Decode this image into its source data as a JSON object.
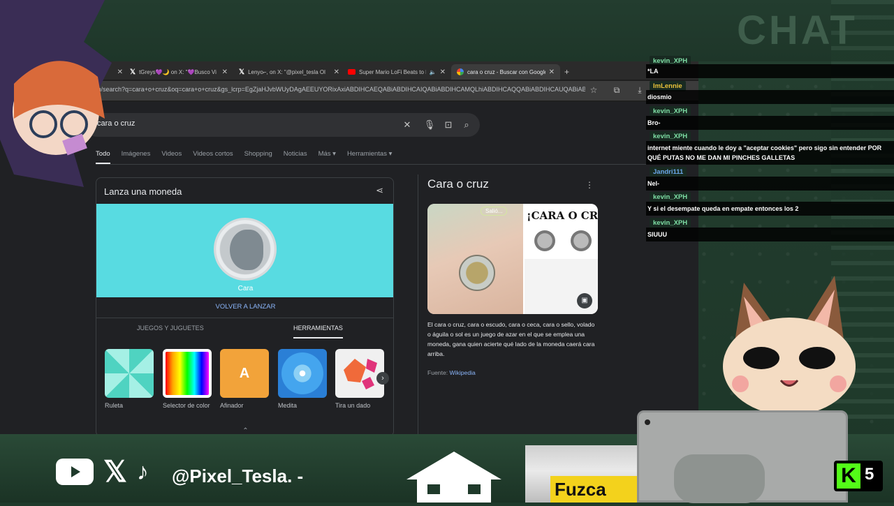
{
  "overlay": {
    "chat_title": "CHAT",
    "handle": "@Pixel_Tesla. -",
    "brand": "Fuzca",
    "kick_count": "5"
  },
  "browser": {
    "tabs": [
      {
        "title": "",
        "favicon": "x-icon"
      },
      {
        "title": "tGreys💜🌙 on X: \"💜Busco Vi",
        "favicon": "x-icon"
      },
      {
        "title": "Lenyo⌐, on X: \"@pixel_tesla Ol",
        "favicon": "x-icon"
      },
      {
        "title": "Super Mario LoFi Beats to F",
        "favicon": "youtube-icon"
      },
      {
        "title": "cara o cruz - Buscar con Google",
        "favicon": "google-icon"
      }
    ],
    "new_tab": "+",
    "url": "e.com/search?q=cara+o+cruz&oq=cara+o+cruz&gs_lcrp=EgZjaHJvbWUyDAgAEEUYORixAxiABDIHCAEQABiABDIHCAIQABiABDIHCAMQLhiABDIHCAQQABiABDIHCAUQABiAB..."
  },
  "search": {
    "query": "cara o cruz",
    "tabs": [
      "Todo",
      "Imágenes",
      "Videos",
      "Videos cortos",
      "Shopping",
      "Noticias",
      "Más ▾",
      "Herramientas ▾"
    ]
  },
  "coin_card": {
    "title": "Lanza una moneda",
    "result": "Cara",
    "relaunch": "VOLVER A LANZAR",
    "subtabs": [
      "JUEGOS Y JUGUETES",
      "HERRAMIENTAS"
    ],
    "tools": [
      "Ruleta",
      "Selector de color",
      "Afinador",
      "Medita",
      "Tira un dado"
    ],
    "afinador_letter": "A"
  },
  "knowledge_panel": {
    "title": "Cara o cruz",
    "image_caption": "Salió...",
    "image_text": "¡CARA O CRUZ",
    "description": "El cara o cruz, cara o escudo, cara o ceca,  cara o sello, volado o águila o sol es un juego de azar en el que se emplea una moneda, gana quien acierte qué lado de la moneda caerá cara arriba.",
    "source_label": "Fuente:",
    "source_link": "Wikipedia"
  },
  "chat": [
    {
      "user": "kevin_XPH",
      "color": "#7fe0a6",
      "text": "*LA"
    },
    {
      "user": "ImLennie",
      "color": "#e9c13a",
      "text": "diosmio"
    },
    {
      "user": "kevin_XPH",
      "color": "#7fe0a6",
      "text": "Bro-"
    },
    {
      "user": "kevin_XPH",
      "color": "#7fe0a6",
      "text": "internet miente cuando le doy a \"aceptar cookies\" pero sigo sin entender POR QUÉ PUTAS NO ME DAN MI PINCHES GALLETAS"
    },
    {
      "user": "Jandri111",
      "color": "#6aa6e8",
      "text": "Nel-"
    },
    {
      "user": "kevin_XPH",
      "color": "#7fe0a6",
      "text": "Y si el desempate queda en empate entonces los 2"
    },
    {
      "user": "kevin_XPH",
      "color": "#7fe0a6",
      "text": "SIUUU"
    }
  ]
}
